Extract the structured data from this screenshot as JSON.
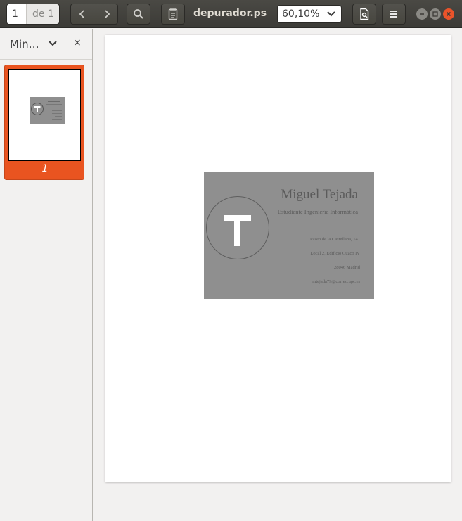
{
  "toolbar": {
    "page_current": "1",
    "page_total": "de 1",
    "prev_icon": "chevron-left-icon",
    "next_icon": "chevron-right-icon",
    "search_icon": "search-icon",
    "annotate_icon": "notepad-icon",
    "document_title": "depurador.ps",
    "zoom_value": "60,10%",
    "zoom_dropdown_icon": "chevron-down-icon",
    "document_menu_icon": "document-search-icon",
    "hamburger_icon": "menu-icon"
  },
  "window_controls": {
    "minimize_icon": "minimize-icon",
    "maximize_icon": "maximize-icon",
    "close_icon": "close-icon",
    "close_color": "#e9532a"
  },
  "sidebar": {
    "mode_label": "Min…",
    "close_label": "×",
    "thumbnails": [
      {
        "page_label": "1",
        "selected": true
      }
    ],
    "accent_color": "#e95420"
  },
  "document": {
    "card": {
      "name": "Miguel Tejada",
      "subtitle": "Estudiante Ingeniería Informática",
      "address_line1": "Paseo de la Castellana, 141",
      "address_line2": "Local 2, Edificio Cuzco IV",
      "address_line3": "28046 Madrid",
      "email": "mtejada79@correo.upc.es",
      "logo_letter": "T",
      "background_color": "#8f8f8f"
    }
  }
}
